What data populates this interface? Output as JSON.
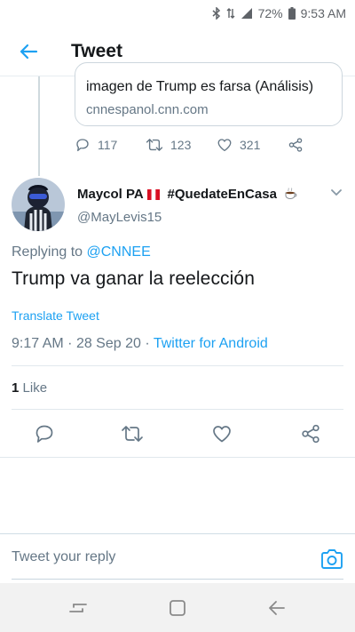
{
  "status_bar": {
    "battery": "72%",
    "time": "9:53 AM",
    "icons": [
      "bluetooth-icon",
      "data-icon",
      "signal-icon",
      "battery-icon"
    ]
  },
  "app_bar": {
    "title": "Tweet",
    "back_icon": "arrow-left-icon",
    "accent": "#1da1f2"
  },
  "quoted_tweet": {
    "link_card": {
      "title": "imagen de Trump es farsa (Análisis)",
      "domain": "cnnespanol.cnn.com"
    },
    "actions": {
      "replies": "117",
      "retweets": "123",
      "likes": "321"
    }
  },
  "tweet": {
    "display_name": "Maycol PA",
    "hashtag": "#QuedateEnCasa",
    "handle": "@MayLevis15",
    "reply_prefix": "Replying to",
    "reply_to": "@CNNEE",
    "text": "Trump va ganar la reelección",
    "translate_label": "Translate Tweet",
    "time": "9:17 AM",
    "date": "28 Sep 20",
    "sep": "·",
    "source": "Twitter for Android",
    "likes_count": "1",
    "likes_label": "Like"
  },
  "reply_composer": {
    "placeholder": "Tweet your reply"
  },
  "colors": {
    "link_blue": "#1da1f2",
    "secondary_text": "#657786",
    "peru_red": "#d91023"
  }
}
